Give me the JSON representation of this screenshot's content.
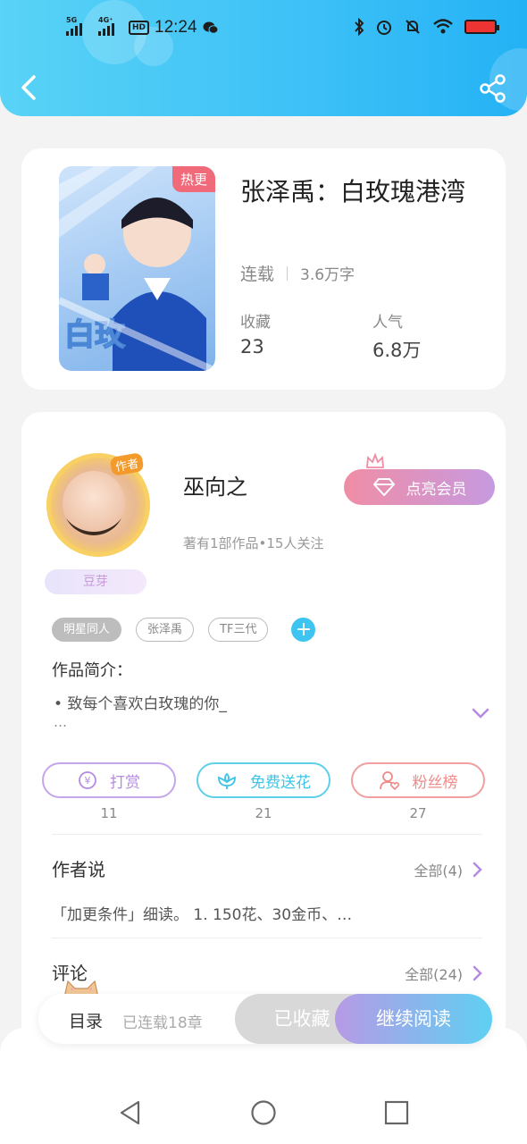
{
  "status_bar": {
    "network1": "5G",
    "network2": "4G⁺",
    "hd": "HD",
    "time": "12:24"
  },
  "book": {
    "cover_tag": "热更",
    "title": "张泽禹：白玫瑰港湾",
    "status": "连载",
    "word_count": "3.6万字",
    "favorites_label": "收藏",
    "favorites_value": "23",
    "popularity_label": "人气",
    "popularity_value": "6.8万"
  },
  "author": {
    "avatar_badge": "作者",
    "name": "巫向之",
    "stats": "著有1部作品•15人关注",
    "rank": "豆芽",
    "vip_label": "点亮会员"
  },
  "tags": [
    "明星同人",
    "张泽禹",
    "TF三代"
  ],
  "intro": {
    "label": "作品简介：",
    "text": "• 致每个喜欢白玫瑰的你_",
    "more": "…"
  },
  "actions": [
    {
      "label": "打赏",
      "count": "11",
      "color": "#b48be0"
    },
    {
      "label": "免费送花",
      "count": "21",
      "color": "#3dc4e6"
    },
    {
      "label": "粉丝榜",
      "count": "27",
      "color": "#ef8a8a"
    }
  ],
  "author_says": {
    "title": "作者说",
    "more": "全部(4)",
    "text": "「加更条件」细读。 1. 150花、30金币、…"
  },
  "comments": {
    "title": "评论",
    "more": "全部(24)"
  },
  "bottom_bar": {
    "toc": "目录",
    "toc_status": "已连载18章",
    "collected": "已收藏",
    "continue": "继续阅读"
  },
  "colors": {
    "header_start": "#59d3f6",
    "header_end": "#24b2f5",
    "accent_purple": "#b48be0",
    "accent_blue": "#3dc4f1"
  }
}
